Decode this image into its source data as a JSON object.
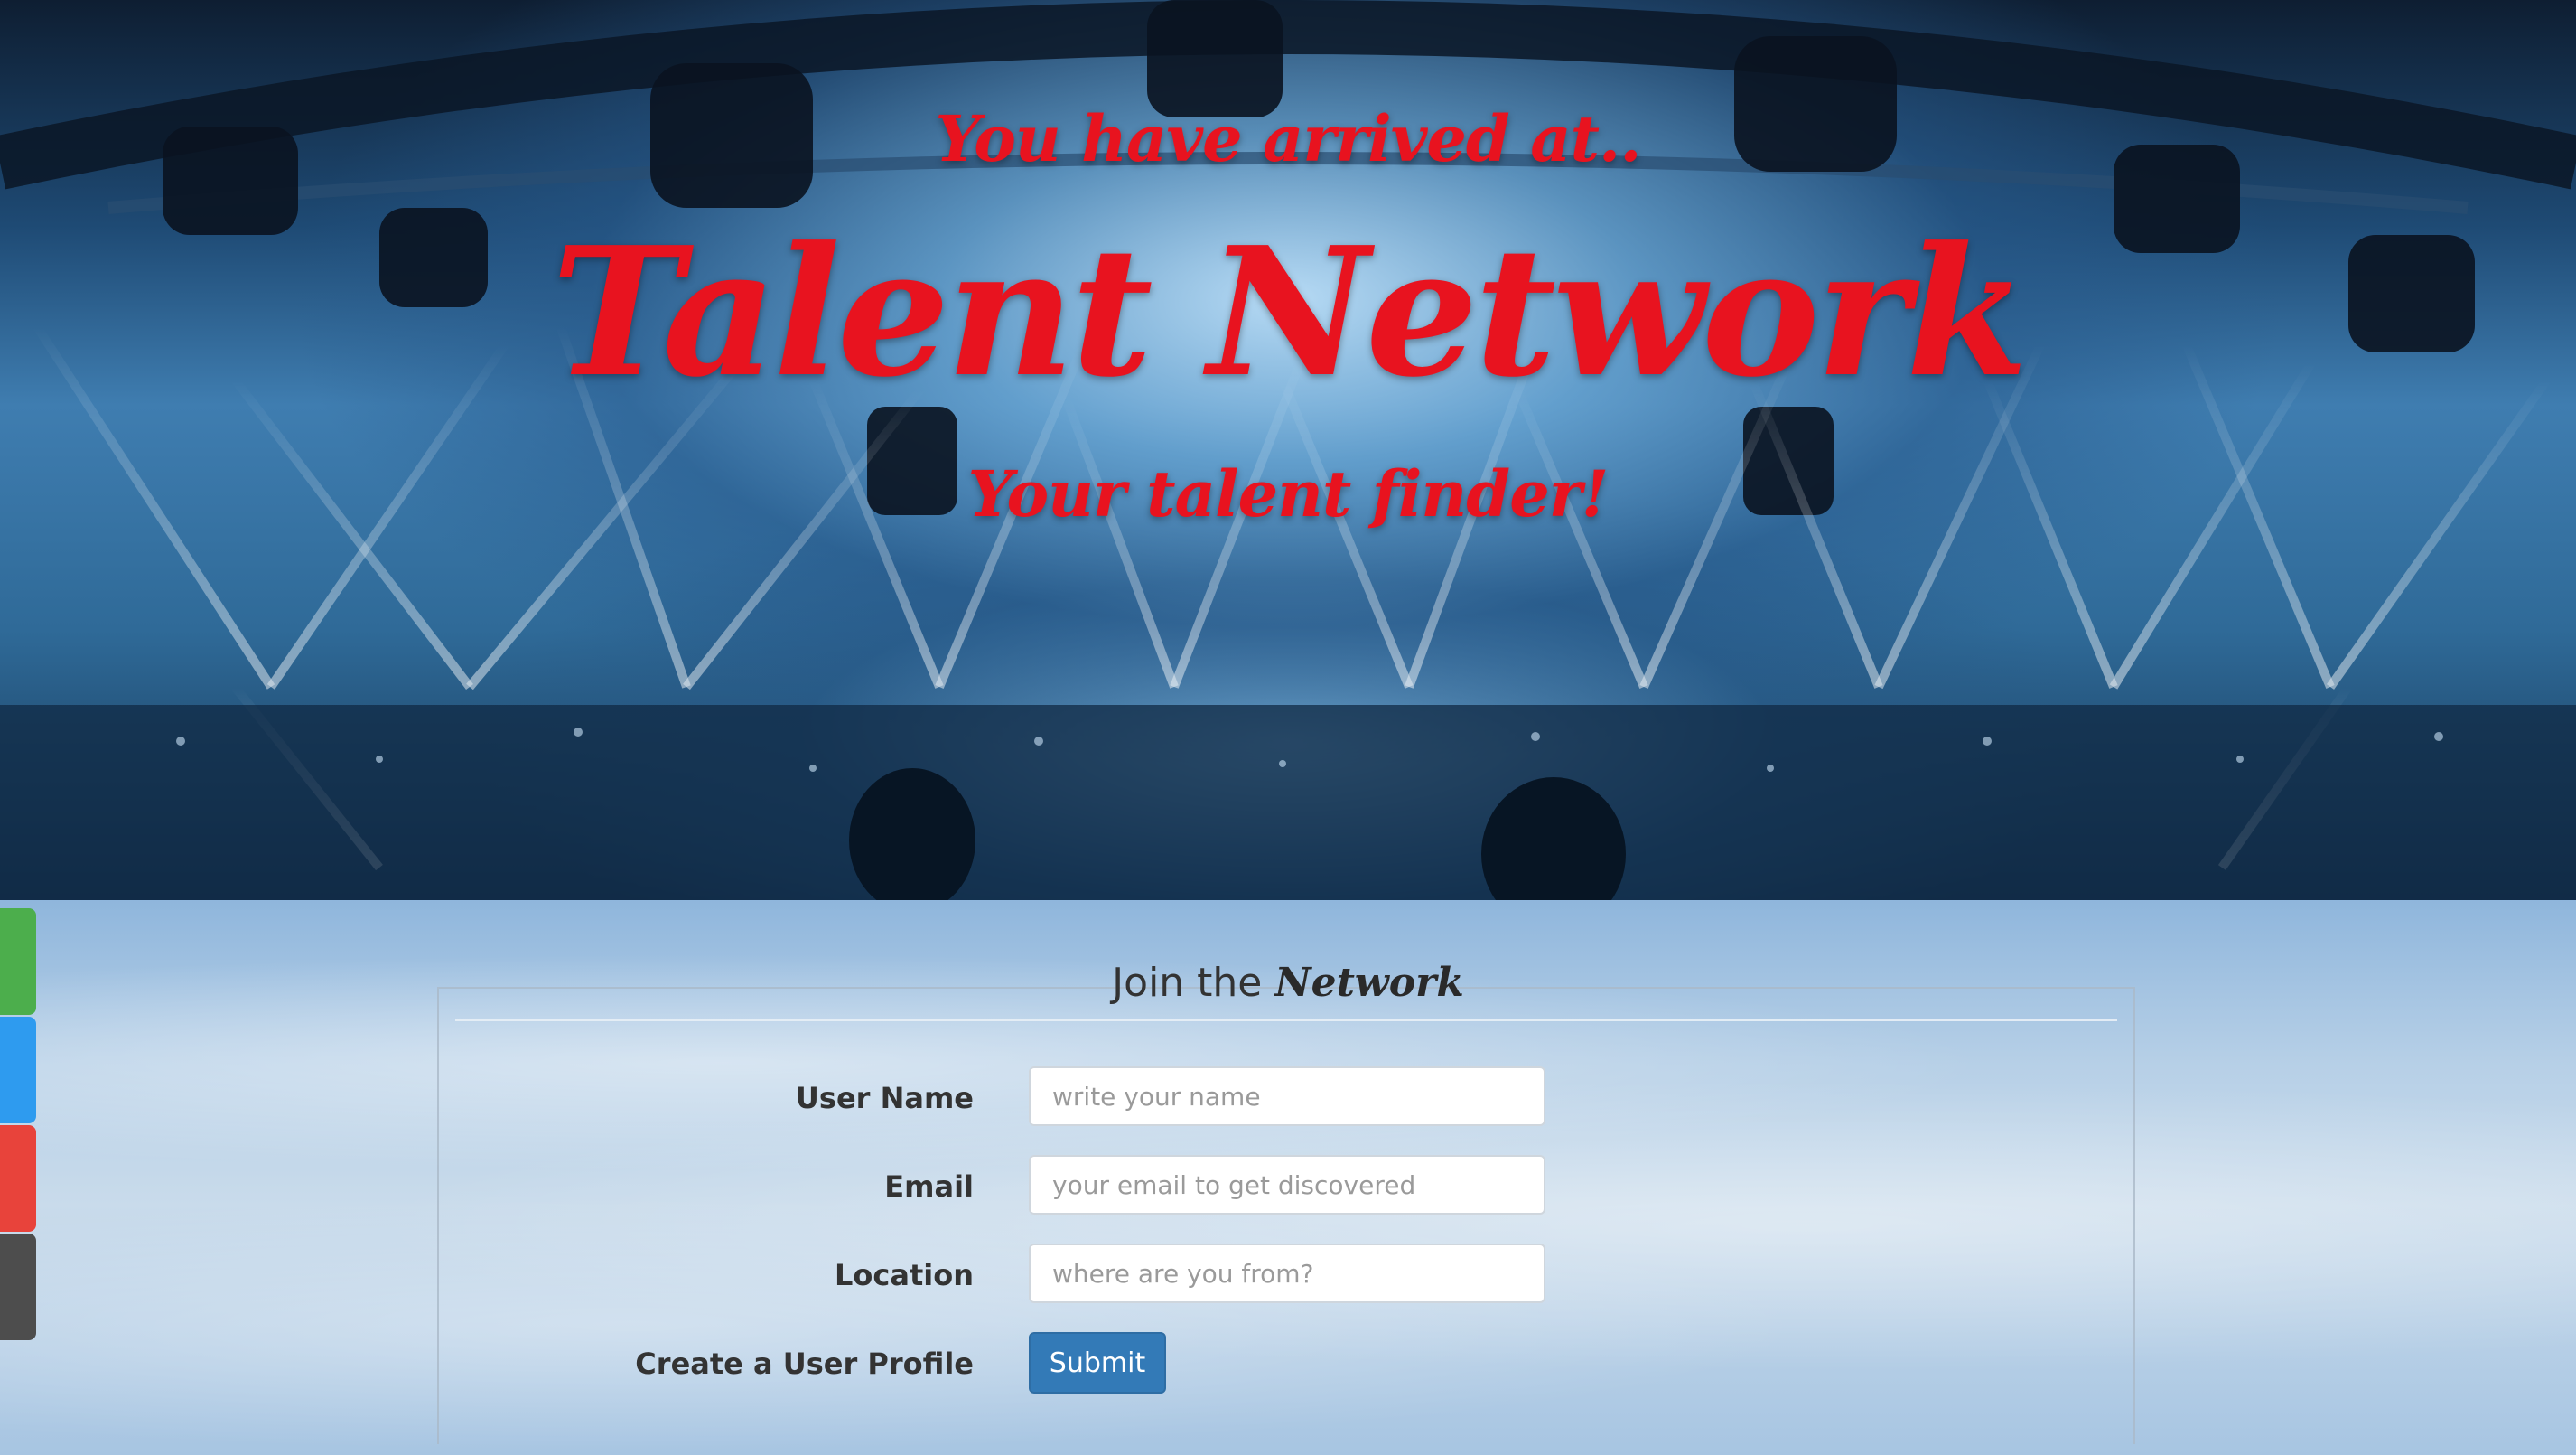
{
  "hero": {
    "pretitle": "You have arrived at..",
    "title": "Talent Network",
    "tagline": "Your talent finder!"
  },
  "form": {
    "heading_prefix": "Join the",
    "heading_brand": "Network",
    "fields": [
      {
        "label": "User Name",
        "placeholder": "write your name",
        "value": ""
      },
      {
        "label": "Email",
        "placeholder": "your email to get discovered",
        "value": ""
      },
      {
        "label": "Location",
        "placeholder": "where are you from?",
        "value": ""
      }
    ],
    "submit_row_label": "Create a User Profile",
    "submit_label": "Submit"
  },
  "social_tabs": [
    {
      "name": "green-tab",
      "color": "#4cae4c"
    },
    {
      "name": "blue-tab",
      "color": "#2e9bef"
    },
    {
      "name": "red-tab",
      "color": "#e8433b"
    },
    {
      "name": "dark-tab",
      "color": "#4d4d4d"
    }
  ],
  "colors": {
    "hero_text": "#e8131f",
    "submit_button": "#337ab7"
  }
}
